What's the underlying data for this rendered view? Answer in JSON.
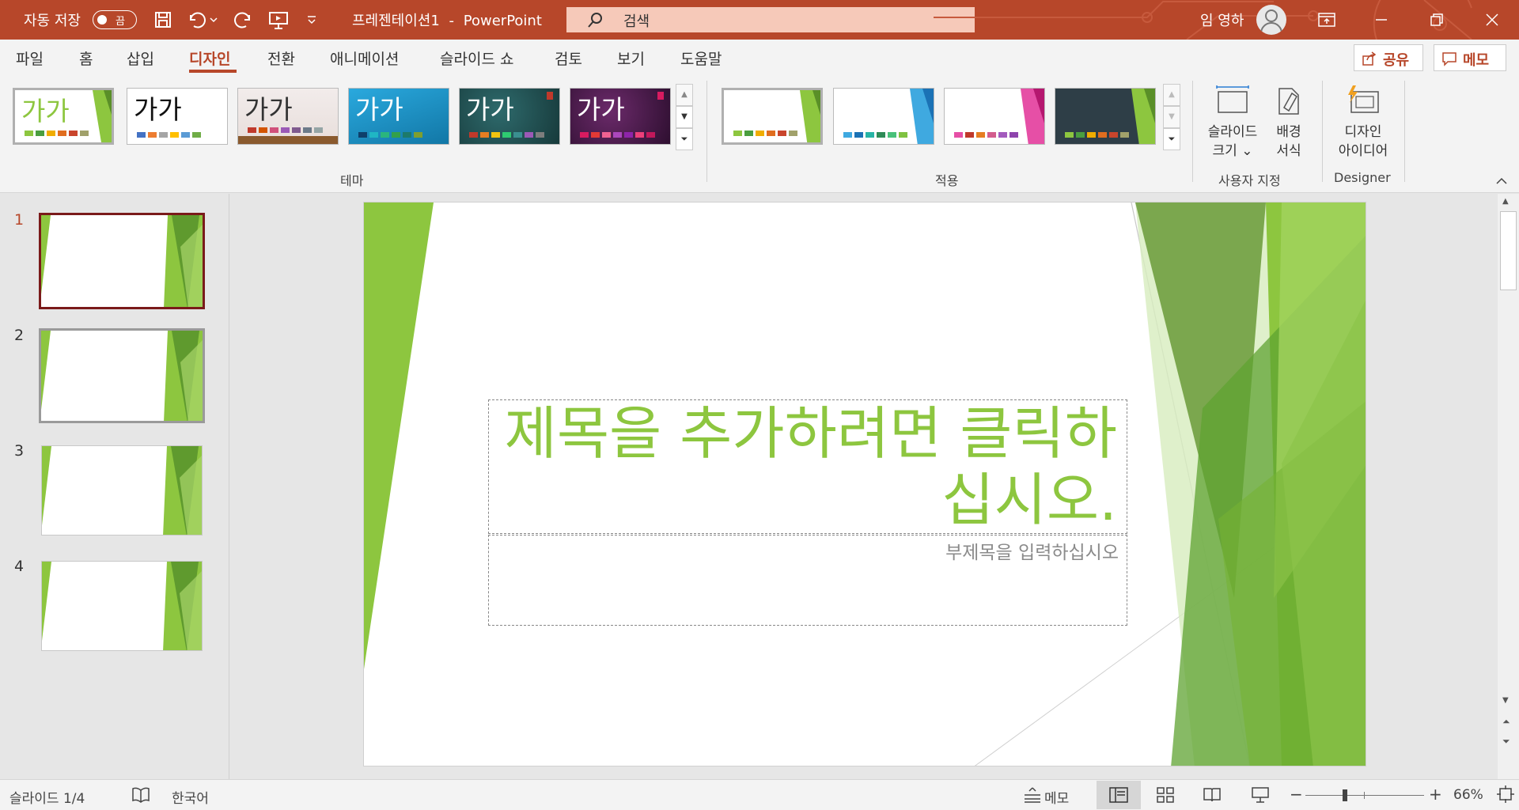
{
  "titlebar": {
    "autosave_label": "자동 저장",
    "autosave_state": "끔",
    "doc_title": "프레젠테이션1",
    "app_name": "PowerPoint",
    "title_sep": "-",
    "search_placeholder": "검색",
    "user_name": "임 영하"
  },
  "tabs": [
    "파일",
    "홈",
    "삽입",
    "디자인",
    "전환",
    "애니메이션",
    "슬라이드 쇼",
    "검토",
    "보기",
    "도움말"
  ],
  "active_tab": "디자인",
  "share_label": "공유",
  "comments_label": "메모",
  "theme_sample_text": "가가",
  "groups": {
    "themes": "테마",
    "variants": "적용",
    "customize": "사용자 지정",
    "designer": "Designer"
  },
  "buttons": {
    "slide_size": [
      "슬라이드",
      "크기 ⌄"
    ],
    "format_bg": [
      "배경",
      "서식"
    ],
    "design_ideas": [
      "디자인",
      "아이디어"
    ]
  },
  "slide_numbers": [
    "1",
    "2",
    "3",
    "4"
  ],
  "slide": {
    "title": "제목을 추가하려면 클릭하십시오.",
    "subtitle": "부제목을 입력하십시오"
  },
  "status": {
    "slide_info": "슬라이드 1/4",
    "language": "한국어",
    "notes": "메모",
    "zoom": "66%"
  },
  "accent_color": "#b7472a"
}
